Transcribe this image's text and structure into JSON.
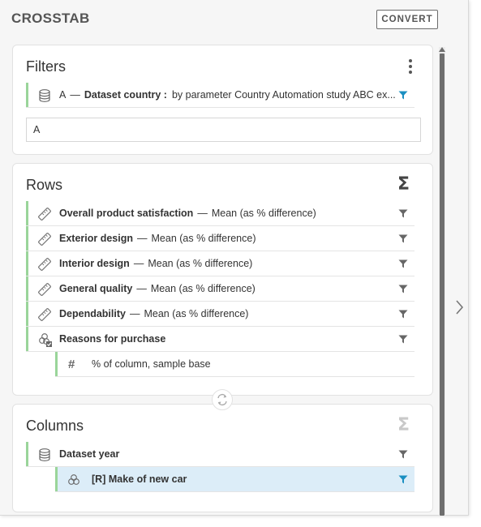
{
  "panel": {
    "title": "CROSSTAB",
    "convert_label": "CONVERT"
  },
  "filters": {
    "title": "Filters",
    "row": {
      "prefix": "A",
      "dash": "—",
      "name": "Dataset country :",
      "detail": "by parameter Country Automation study ABC ex..."
    },
    "value_input": "A"
  },
  "rows": {
    "title": "Rows",
    "sigma": "Σ",
    "items": [
      {
        "name": "Overall product satisfaction",
        "dash": "—",
        "detail": "Mean (as % difference)",
        "icon": "ruler-icon"
      },
      {
        "name": "Exterior design",
        "dash": "—",
        "detail": "Mean (as % difference)",
        "icon": "ruler-icon"
      },
      {
        "name": "Interior design",
        "dash": "—",
        "detail": "Mean (as % difference)",
        "icon": "ruler-icon"
      },
      {
        "name": "General quality",
        "dash": "—",
        "detail": "Mean (as % difference)",
        "icon": "ruler-icon"
      },
      {
        "name": "Dependability",
        "dash": "—",
        "detail": "Mean (as % difference)",
        "icon": "ruler-icon"
      },
      {
        "name": "Reasons for purchase",
        "icon": "multi-response-icon"
      }
    ],
    "child": {
      "symbol": "#",
      "label": "% of column, sample base"
    }
  },
  "columns": {
    "title": "Columns",
    "sigma": "Σ",
    "items": [
      {
        "name": "Dataset year",
        "icon": "database-icon"
      }
    ],
    "child": {
      "name": "[R] Make of new car",
      "icon": "categorical-icon"
    }
  },
  "colors": {
    "accent_green": "#9ad59a",
    "filter_active": "#1a8fc1",
    "filter_inactive": "#666666",
    "selected_row": "#dcedf8"
  }
}
